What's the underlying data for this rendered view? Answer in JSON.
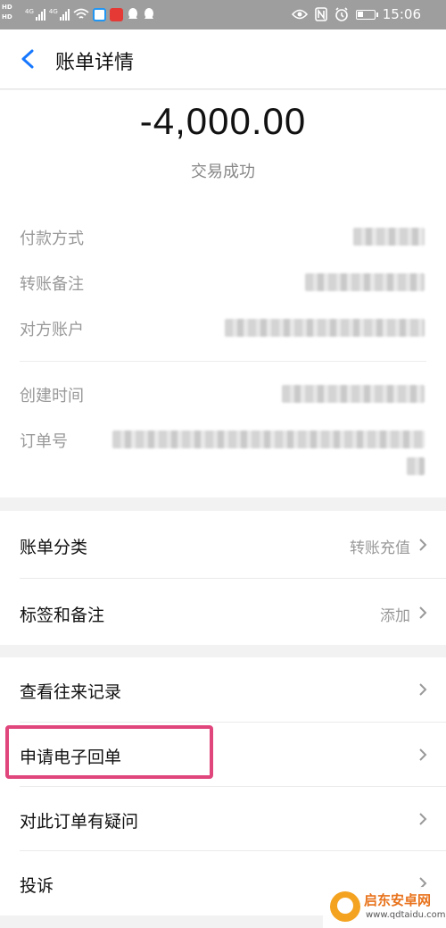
{
  "status_bar": {
    "hd_top": "HD",
    "hd_bottom": "HD",
    "net1": "4G",
    "net2": "4G",
    "time": "15:06",
    "icons": [
      "signal-icon",
      "wifi-icon",
      "app-icon",
      "app-icon",
      "qq-icon",
      "qq-icon",
      "eye-icon",
      "nfc-icon",
      "alarm-icon",
      "battery-icon"
    ]
  },
  "nav": {
    "back_icon": "chevron-left-icon",
    "title": "账单详情"
  },
  "summary": {
    "amount": "-4,000.00",
    "status": "交易成功"
  },
  "details": {
    "payment_method": "付款方式",
    "transfer_note": "转账备注",
    "counterparty": "对方账户",
    "created_time": "创建时间",
    "order_no": "订单号"
  },
  "rows": {
    "category": {
      "label": "账单分类",
      "value": "转账充值"
    },
    "tags": {
      "label": "标签和备注",
      "value": "添加"
    },
    "history": {
      "label": "查看往来记录"
    },
    "receipt": {
      "label": "申请电子回单"
    },
    "question": {
      "label": "对此订单有疑问"
    },
    "complaint": {
      "label": "投诉"
    }
  },
  "watermark": {
    "name": "启东安卓网",
    "url": "www.qdtaidu.com"
  },
  "colors": {
    "highlight": "#e0467c",
    "back_arrow": "#1677ff"
  }
}
